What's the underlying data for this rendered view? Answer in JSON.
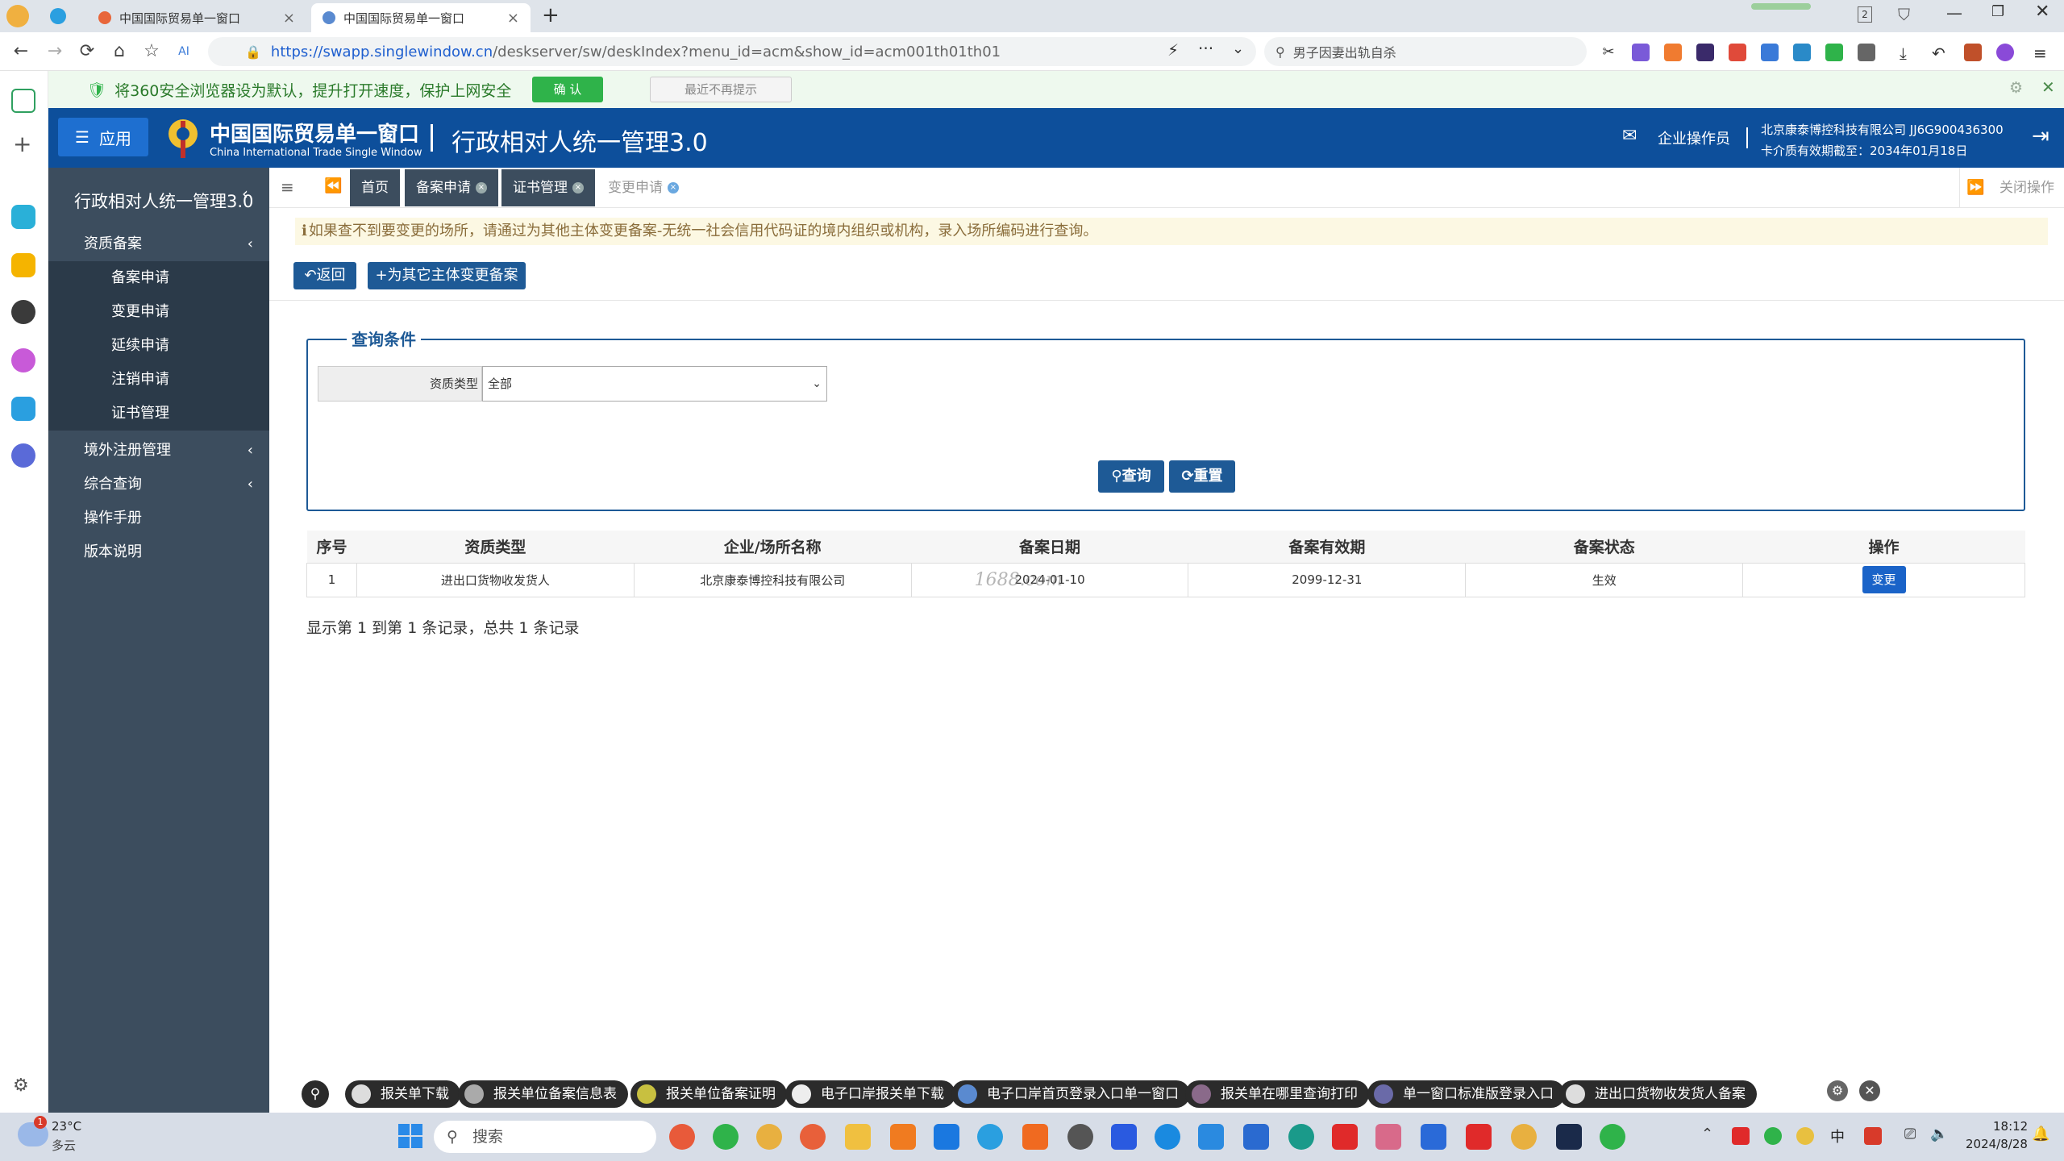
{
  "browser": {
    "tabs": [
      {
        "label": "中国国际贸易单一窗口"
      },
      {
        "label": "中国国际贸易单一窗口"
      }
    ],
    "url_prefix": "https://",
    "url_host": "swapp.singlewindow.cn",
    "url_path": "/deskserver/sw/deskIndex?menu_id=acm&show_id=acm001th01th01",
    "search_placeholder": "男子因妻出轨自杀",
    "tab_count": "2"
  },
  "infobar": {
    "message": "将360安全浏览器设为默认，提升打开速度，保护上网安全",
    "confirm": "确 认",
    "dismiss": "最近不再提示"
  },
  "header": {
    "app_button": "应用",
    "brand_cn": "中国国际贸易单一窗口",
    "brand_en": "China International Trade Single Window",
    "system_name": "行政相对人统一管理3.0",
    "user_role": "企业操作员",
    "company": "北京康泰博控科技有限公司 JJ6G900436300",
    "card_expiry": "卡介质有效期截至：2034年01月18日"
  },
  "sidebar": {
    "title": "行政相对人统一管理3.0",
    "items": [
      {
        "label": "资质备案"
      },
      {
        "label": "备案申请"
      },
      {
        "label": "变更申请"
      },
      {
        "label": "延续申请"
      },
      {
        "label": "注销申请"
      },
      {
        "label": "证书管理"
      },
      {
        "label": "境外注册管理"
      },
      {
        "label": "综合查询"
      },
      {
        "label": "操作手册"
      },
      {
        "label": "版本说明"
      }
    ]
  },
  "page_tabs": {
    "items": [
      {
        "label": "首页"
      },
      {
        "label": "备案申请"
      },
      {
        "label": "证书管理"
      },
      {
        "label": "变更申请"
      }
    ],
    "close_ops": "关闭操作"
  },
  "content": {
    "notice": "如果查不到要变更的场所，请通过为其他主体变更备案-无统一社会信用代码证的境内组织或机构，录入场所编码进行查询。",
    "back_button": "返回",
    "other_subject_button": "为其它主体变更备案",
    "query_title": "查询条件",
    "qual_type_label": "资质类型",
    "qual_type_value": "全部",
    "query_button": "查询",
    "reset_button": "重置"
  },
  "table": {
    "headers": [
      "序号",
      "资质类型",
      "企业/场所名称",
      "备案日期",
      "备案有效期",
      "备案状态",
      "操作"
    ],
    "rows": [
      [
        "1",
        "进出口货物收发货人",
        "北京康泰博控科技有限公司",
        "2024-01-10",
        "2099-12-31",
        "生效",
        "变更"
      ]
    ],
    "summary": "显示第 1 到第 1 条记录，总共 1 条记录",
    "watermark": "1688.com"
  },
  "bottom_pills": [
    {
      "label": "报关单下载"
    },
    {
      "label": "报关单位备案信息表"
    },
    {
      "label": "报关单位备案证明"
    },
    {
      "label": "电子口岸报关单下载"
    },
    {
      "label": "电子口岸首页登录入口单一窗口"
    },
    {
      "label": "报关单在哪里查询打印"
    },
    {
      "label": "单一窗口标准版登录入口"
    },
    {
      "label": "进出口货物收发货人备案"
    }
  ],
  "taskbar": {
    "weather_temp": "23°C",
    "weather_desc": "多云",
    "weather_badge": "1",
    "search_placeholder": "搜索",
    "ime": "中",
    "time": "18:12",
    "date": "2024/8/28"
  },
  "colors": {
    "header_blue": "#0d4f9b",
    "sidebar_bg": "#3c4d5e",
    "accent": "#1e5a96",
    "notice_bg": "#fcf8e3"
  }
}
